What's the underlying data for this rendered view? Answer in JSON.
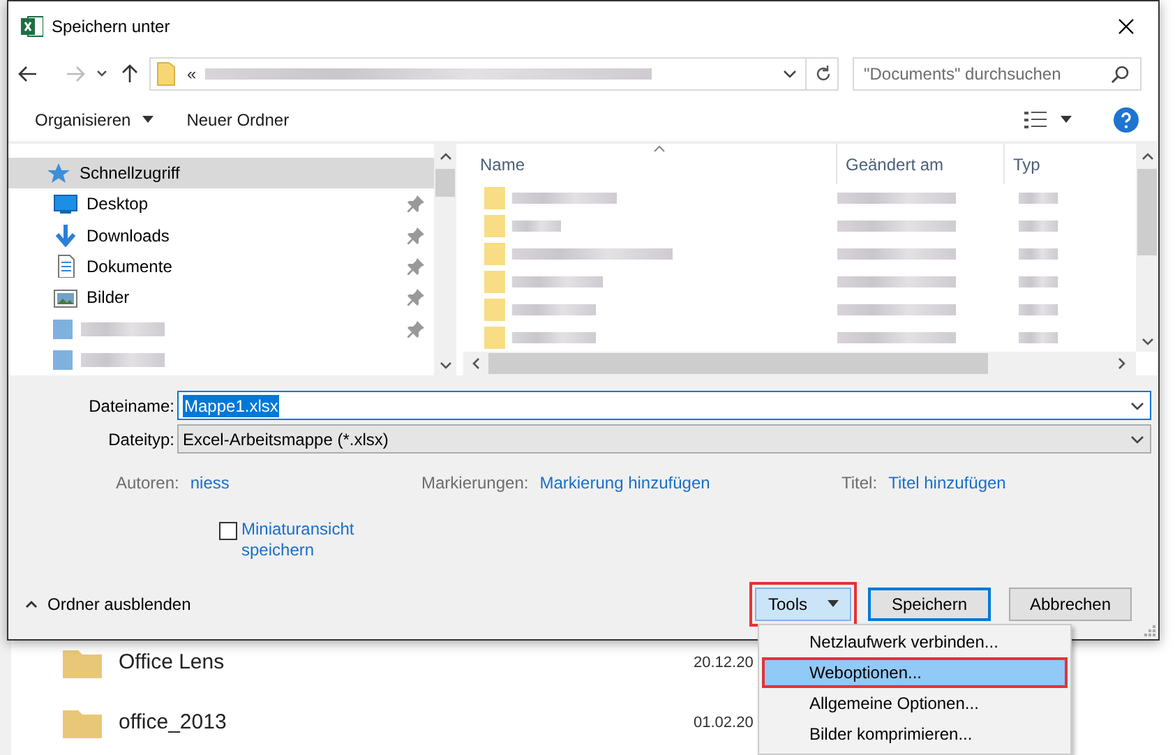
{
  "background": {
    "rows": [
      {
        "name": "Office Lens",
        "date": "20.12.20"
      },
      {
        "name": "office_2013",
        "date": "01.02.20"
      }
    ]
  },
  "title_bar": {
    "title": "Speichern unter"
  },
  "address_bar": {
    "prefix": "«"
  },
  "search": {
    "placeholder": "\"Documents\" durchsuchen"
  },
  "toolbar": {
    "organize": "Organisieren",
    "new_folder": "Neuer Ordner"
  },
  "navigation": {
    "items": [
      {
        "kind": "item",
        "label": "Schnellzugriff",
        "selected": true,
        "pinned": false
      },
      {
        "kind": "item",
        "label": "Desktop",
        "selected": false,
        "pinned": true
      },
      {
        "kind": "item",
        "label": "Downloads",
        "selected": false,
        "pinned": true
      },
      {
        "kind": "item",
        "label": "Dokumente",
        "selected": false,
        "pinned": true
      },
      {
        "kind": "item",
        "label": "Bilder",
        "selected": false,
        "pinned": true
      },
      {
        "kind": "blurred",
        "selected": false,
        "pinned": true
      },
      {
        "kind": "blurred",
        "selected": false,
        "pinned": false
      }
    ]
  },
  "file_list": {
    "columns": [
      "Name",
      "Geändert am",
      "Typ"
    ]
  },
  "form": {
    "filename": {
      "label": "Dateiname:",
      "value": "Mappe1.xlsx"
    },
    "filetype": {
      "label": "Dateityp:",
      "value": "Excel-Arbeitsmappe (*.xlsx)"
    },
    "meta": [
      {
        "label": "Autoren:",
        "value": "niess"
      },
      {
        "label": "Markierungen:",
        "value": "Markierung hinzufügen"
      },
      {
        "label": "Titel:",
        "value": "Titel hinzufügen"
      }
    ],
    "thumbnail": {
      "label": "Miniaturansicht speichern",
      "checked": false
    }
  },
  "footer": {
    "hide_folders": "Ordner ausblenden",
    "tools": {
      "label": "Tools",
      "highlighted": true
    },
    "save": "Speichern",
    "cancel": "Abbrechen"
  },
  "tools_menu": [
    {
      "label": "Netzlaufwerk verbinden...",
      "selected": false,
      "highlighted": false
    },
    {
      "label": "Weboptionen...",
      "selected": true,
      "highlighted": true
    },
    {
      "label": "Allgemeine Optionen...",
      "selected": false,
      "highlighted": false
    },
    {
      "label": "Bilder komprimieren...",
      "selected": false,
      "highlighted": false
    }
  ]
}
